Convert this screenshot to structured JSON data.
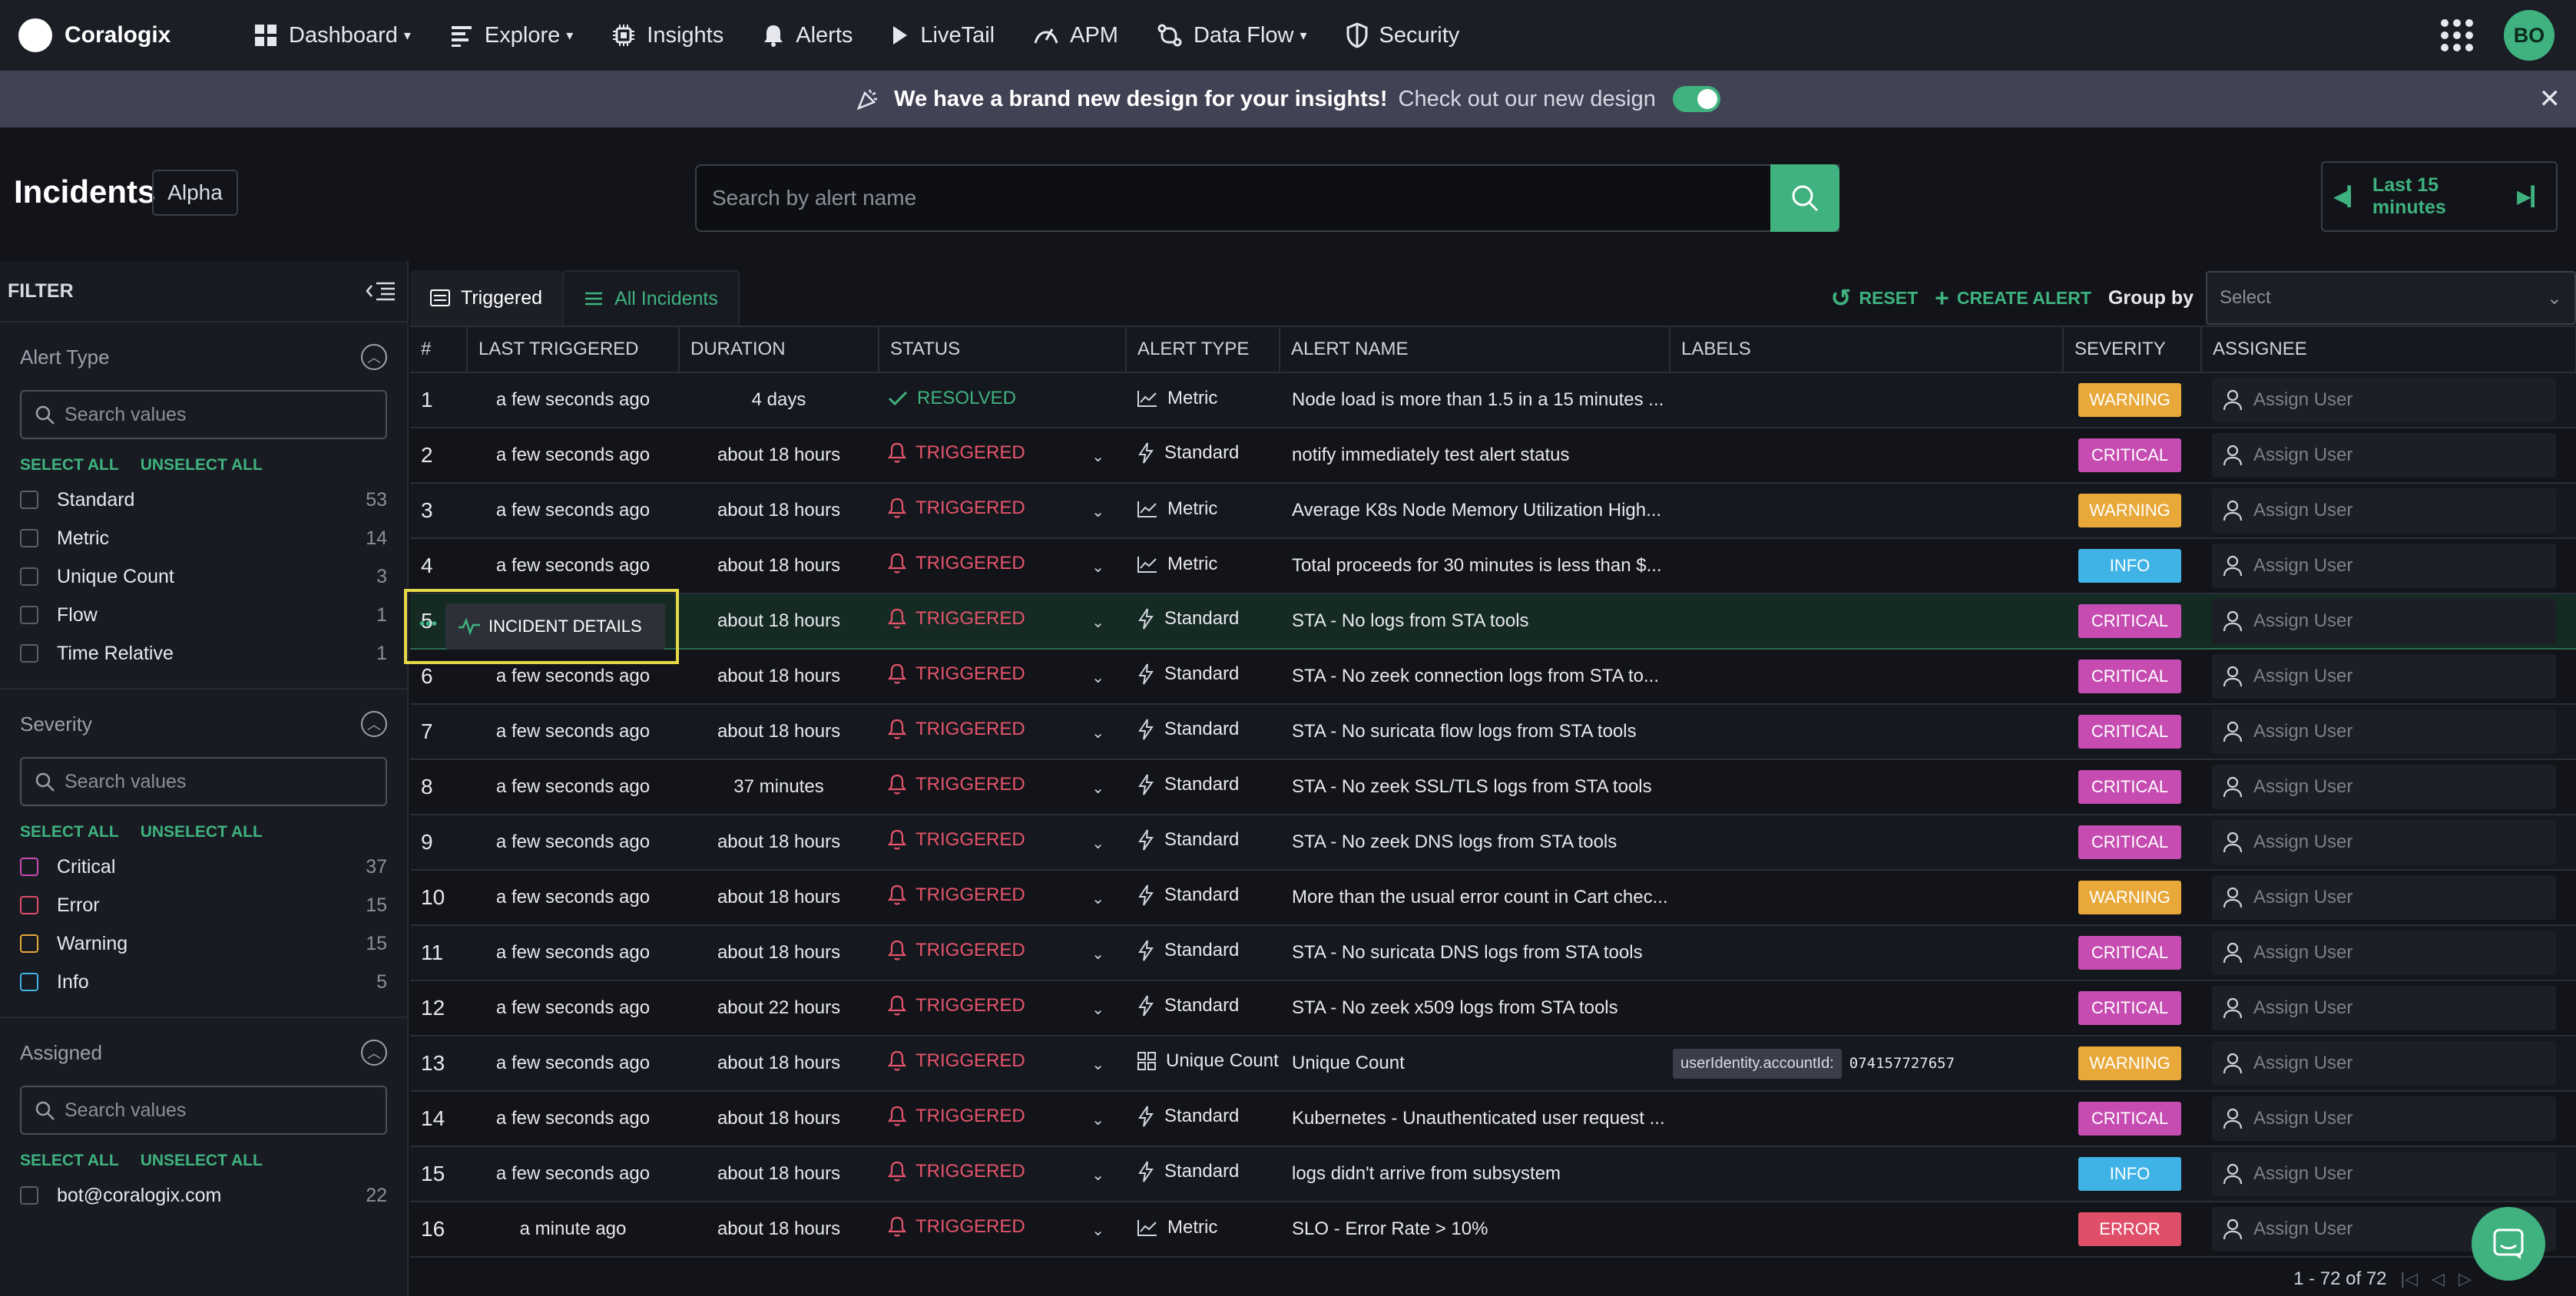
{
  "nav": {
    "brand": "Coralogix",
    "items": [
      {
        "label": "Dashboard",
        "icon": "dashboard-icon",
        "caret": true
      },
      {
        "label": "Explore",
        "icon": "explore-icon",
        "caret": true
      },
      {
        "label": "Insights",
        "icon": "insights-icon",
        "caret": false
      },
      {
        "label": "Alerts",
        "icon": "bell-icon",
        "caret": false
      },
      {
        "label": "LiveTail",
        "icon": "play-icon",
        "caret": false
      },
      {
        "label": "APM",
        "icon": "apm-icon",
        "caret": false
      },
      {
        "label": "Data Flow",
        "icon": "dataflow-icon",
        "caret": true
      },
      {
        "label": "Security",
        "icon": "shield-icon",
        "caret": false
      }
    ],
    "avatar": "BO"
  },
  "banner": {
    "strong": "We have a brand new design for your insights!",
    "sub": "Check out our new design",
    "toggle_on": true,
    "close": "✕"
  },
  "header": {
    "title": "Incidents",
    "badge": "Alpha",
    "search_placeholder": "Search by alert name",
    "time_range": "Last 15 minutes"
  },
  "sidebar": {
    "filter_label": "FILTER",
    "select_all": "SELECT ALL",
    "unselect_all": "UNSELECT ALL",
    "search_placeholder": "Search values",
    "sections": [
      {
        "title": "Alert Type",
        "items": [
          {
            "label": "Standard",
            "count": "53"
          },
          {
            "label": "Metric",
            "count": "14"
          },
          {
            "label": "Unique Count",
            "count": "3"
          },
          {
            "label": "Flow",
            "count": "1"
          },
          {
            "label": "Time Relative",
            "count": "1"
          }
        ]
      },
      {
        "title": "Severity",
        "items": [
          {
            "label": "Critical",
            "count": "37",
            "color": "#c64cb2"
          },
          {
            "label": "Error",
            "count": "15",
            "color": "#df4f6a"
          },
          {
            "label": "Warning",
            "count": "15",
            "color": "#e8a93a"
          },
          {
            "label": "Info",
            "count": "5",
            "color": "#3fb3e6"
          }
        ]
      },
      {
        "title": "Assigned",
        "items": [
          {
            "label": "bot@coralogix.com",
            "count": "22"
          }
        ]
      }
    ]
  },
  "toolbar": {
    "tab_triggered": "Triggered",
    "tab_all": "All Incidents",
    "reset": "RESET",
    "create_alert": "CREATE ALERT",
    "group_by": "Group by",
    "select_placeholder": "Select"
  },
  "table": {
    "headers": [
      "#",
      "LAST TRIGGERED",
      "DURATION",
      "STATUS",
      "ALERT TYPE",
      "ALERT NAME",
      "LABELS",
      "SEVERITY",
      "ASSIGNEE"
    ],
    "assign_placeholder": "Assign User",
    "incident_details": "INCIDENT DETAILS",
    "rows": [
      {
        "num": "1",
        "last": "a few seconds ago",
        "duration": "4 days",
        "status": "RESOLVED",
        "type": "Metric",
        "name": "Node load is more than 1.5 in a 15 minutes ...",
        "severity": "WARNING"
      },
      {
        "num": "2",
        "last": "a few seconds ago",
        "duration": "about 18 hours",
        "status": "TRIGGERED",
        "type": "Standard",
        "name": "notify immediately test alert status",
        "severity": "CRITICAL"
      },
      {
        "num": "3",
        "last": "a few seconds ago",
        "duration": "about 18 hours",
        "status": "TRIGGERED",
        "type": "Metric",
        "name": "Average K8s Node Memory Utilization High...",
        "severity": "WARNING"
      },
      {
        "num": "4",
        "last": "a few seconds ago",
        "duration": "about 18 hours",
        "status": "TRIGGERED",
        "type": "Metric",
        "name": "Total proceeds for 30 minutes is less than $...",
        "severity": "INFO"
      },
      {
        "num": "5",
        "last": "",
        "duration": "about 18 hours",
        "status": "TRIGGERED",
        "type": "Standard",
        "name": "STA - No logs from STA tools",
        "severity": "CRITICAL",
        "highlight": true
      },
      {
        "num": "6",
        "last": "a few seconds ago",
        "duration": "about 18 hours",
        "status": "TRIGGERED",
        "type": "Standard",
        "name": "STA - No zeek connection logs from STA to...",
        "severity": "CRITICAL"
      },
      {
        "num": "7",
        "last": "a few seconds ago",
        "duration": "about 18 hours",
        "status": "TRIGGERED",
        "type": "Standard",
        "name": "STA - No suricata flow logs from STA tools",
        "severity": "CRITICAL"
      },
      {
        "num": "8",
        "last": "a few seconds ago",
        "duration": "37 minutes",
        "status": "TRIGGERED",
        "type": "Standard",
        "name": "STA - No zeek SSL/TLS logs from STA tools",
        "severity": "CRITICAL"
      },
      {
        "num": "9",
        "last": "a few seconds ago",
        "duration": "about 18 hours",
        "status": "TRIGGERED",
        "type": "Standard",
        "name": "STA - No zeek DNS logs from STA tools",
        "severity": "CRITICAL"
      },
      {
        "num": "10",
        "last": "a few seconds ago",
        "duration": "about 18 hours",
        "status": "TRIGGERED",
        "type": "Standard",
        "name": "More than the usual error count in Cart chec...",
        "severity": "WARNING"
      },
      {
        "num": "11",
        "last": "a few seconds ago",
        "duration": "about 18 hours",
        "status": "TRIGGERED",
        "type": "Standard",
        "name": "STA - No suricata DNS logs from STA tools",
        "severity": "CRITICAL"
      },
      {
        "num": "12",
        "last": "a few seconds ago",
        "duration": "about 22 hours",
        "status": "TRIGGERED",
        "type": "Standard",
        "name": "STA - No zeek x509 logs from STA tools",
        "severity": "CRITICAL"
      },
      {
        "num": "13",
        "last": "a few seconds ago",
        "duration": "about 18 hours",
        "status": "TRIGGERED",
        "type": "Unique Count",
        "name": "Unique Count",
        "severity": "WARNING",
        "label_key": "userIdentity.accountId:",
        "label_val": "074157727657"
      },
      {
        "num": "14",
        "last": "a few seconds ago",
        "duration": "about 18 hours",
        "status": "TRIGGERED",
        "type": "Standard",
        "name": "Kubernetes - Unauthenticated user request ...",
        "severity": "CRITICAL"
      },
      {
        "num": "15",
        "last": "a few seconds ago",
        "duration": "about 18 hours",
        "status": "TRIGGERED",
        "type": "Standard",
        "name": "logs didn't arrive from subsystem",
        "severity": "INFO"
      },
      {
        "num": "16",
        "last": "a minute ago",
        "duration": "about 18 hours",
        "status": "TRIGGERED",
        "type": "Metric",
        "name": "SLO - Error Rate > 10%",
        "severity": "ERROR"
      }
    ]
  },
  "pager": {
    "text": "1 - 72 of 72"
  }
}
